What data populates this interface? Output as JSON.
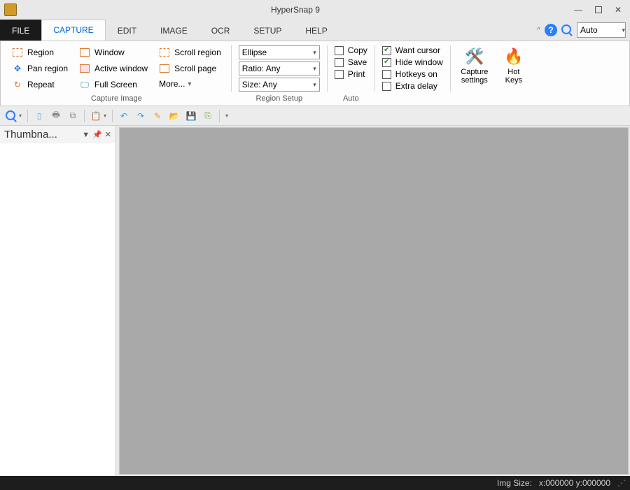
{
  "window": {
    "title": "HyperSnap 9"
  },
  "menu": {
    "tabs": [
      "FILE",
      "CAPTURE",
      "EDIT",
      "IMAGE",
      "OCR",
      "SETUP",
      "HELP"
    ],
    "active": "CAPTURE",
    "zoom_value": "Auto",
    "help_label": "?",
    "pin_glyph": "^"
  },
  "ribbon": {
    "capture_image": {
      "title": "Capture Image",
      "col1": [
        "Region",
        "Pan region",
        "Repeat"
      ],
      "col2": [
        "Window",
        "Active window",
        "Full Screen"
      ],
      "col3": [
        "Scroll region",
        "Scroll page"
      ],
      "more": "More..."
    },
    "region_setup": {
      "title": "Region Setup",
      "shape": "Ellipse",
      "ratio": "Ratio: Any",
      "size": "Size: Any"
    },
    "auto": {
      "title": "Auto",
      "copy": "Copy",
      "save": "Save",
      "print": "Print"
    },
    "opts": {
      "want_cursor": "Want cursor",
      "hide_window": "Hide window",
      "hotkeys_on": "Hotkeys on",
      "extra_delay": "Extra delay"
    },
    "big": {
      "capture_settings": "Capture\nsettings",
      "hot_keys": "Hot\nKeys"
    }
  },
  "panel": {
    "title": "Thumbna..."
  },
  "status": {
    "img_size": "Img Size:",
    "coords": "x:000000  y:000000"
  }
}
